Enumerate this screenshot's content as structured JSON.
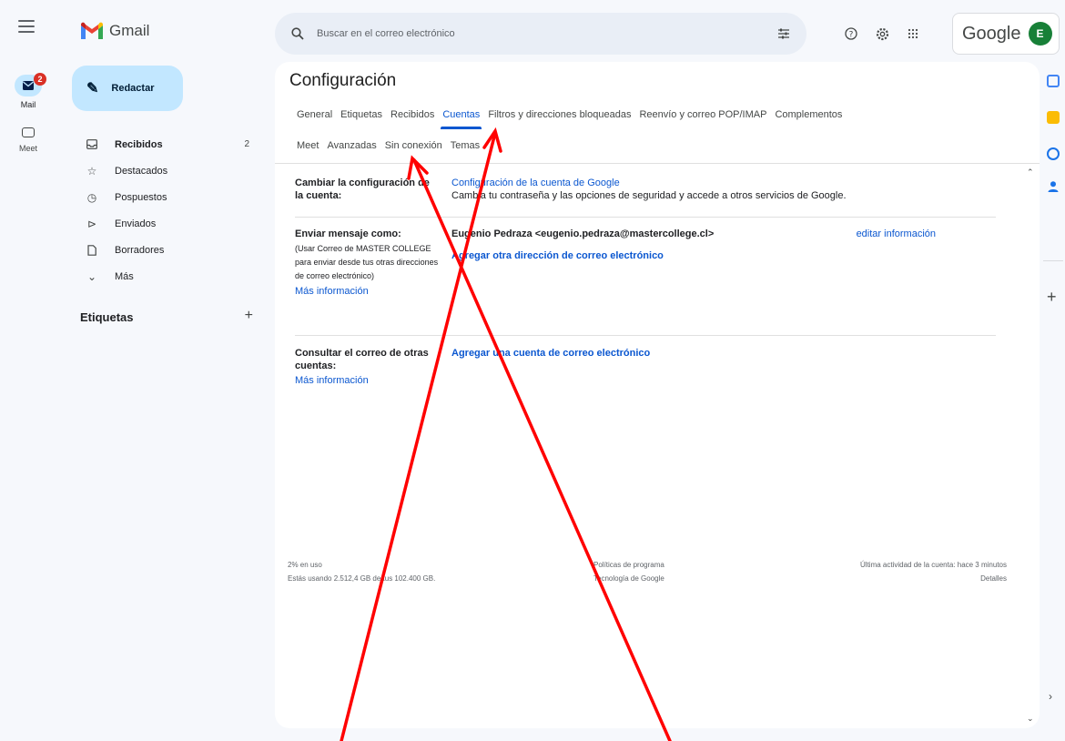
{
  "app": {
    "name": "Gmail",
    "google_label": "Google",
    "avatar_initial": "E"
  },
  "rail": {
    "mail_label": "Mail",
    "mail_badge": "2",
    "meet_label": "Meet"
  },
  "compose": {
    "label": "Redactar"
  },
  "nav": {
    "items": [
      {
        "label": "Recibidos",
        "count": "2"
      },
      {
        "label": "Destacados"
      },
      {
        "label": "Pospuestos"
      },
      {
        "label": "Enviados"
      },
      {
        "label": "Borradores"
      },
      {
        "label": "Más"
      }
    ],
    "labels_heading": "Etiquetas"
  },
  "search": {
    "placeholder": "Buscar en el correo electrónico"
  },
  "settings": {
    "title": "Configuración",
    "tabs_row1": [
      "General",
      "Etiquetas",
      "Recibidos",
      "Cuentas",
      "Filtros y direcciones bloqueadas",
      "Reenvío y correo POP/IMAP",
      "Complementos"
    ],
    "tabs_row2": [
      "Meet",
      "Avanzadas",
      "Sin conexión",
      "Temas"
    ],
    "active_tab": "Cuentas",
    "sections": {
      "change_account": {
        "label": "Cambiar la configuración de la cuenta:",
        "link": "Configuración de la cuenta de Google",
        "desc": "Cambia tu contraseña y las opciones de seguridad y accede a otros servicios de Google."
      },
      "send_as": {
        "label": "Enviar mensaje como:",
        "sub": "(Usar Correo de MASTER COLLEGE para enviar desde tus otras direcciones de correo electrónico)",
        "more": "Más información",
        "identity": "Eugenio Pedraza <eugenio.pedraza@mastercollege.cl>",
        "edit": "editar información",
        "add": "Agregar otra dirección de correo electrónico"
      },
      "check_mail": {
        "label": "Consultar el correo de otras cuentas:",
        "more": "Más información",
        "add": "Agregar una cuenta de correo electrónico"
      }
    },
    "footer": {
      "usage_pct": "2% en uso",
      "usage_detail": "Estás usando 2.512,4 GB de tus 102.400 GB.",
      "policies": "Políticas de programa",
      "powered": "Tecnología de Google",
      "last_activity": "Última actividad de la cuenta: hace 3 minutos",
      "details": "Detalles"
    }
  },
  "colors": {
    "accent": "#0b57d0",
    "annotation_red": "#ff0000"
  }
}
